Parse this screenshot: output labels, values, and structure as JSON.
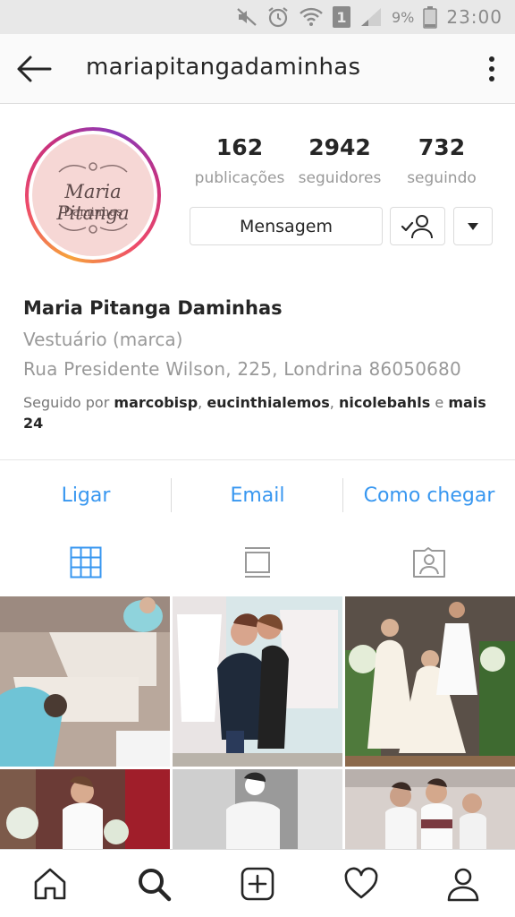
{
  "status_bar": {
    "battery_percent": "9%",
    "time": "23:00",
    "sim_slot": "1",
    "icons": [
      "mute-icon",
      "alarm-icon",
      "wifi-icon",
      "sim-icon",
      "signal-icon",
      "battery-icon"
    ]
  },
  "header": {
    "username": "mariapitangadaminhas",
    "icons": [
      "back-arrow-icon",
      "more-options-icon"
    ]
  },
  "profile": {
    "avatar_text_line1": "Maria Pitanga",
    "avatar_text_line2": "Daminhas",
    "stats": [
      {
        "value": "162",
        "label": "publicações"
      },
      {
        "value": "2942",
        "label": "seguidores"
      },
      {
        "value": "732",
        "label": "seguindo"
      }
    ],
    "message_button": "Mensagem",
    "ring_colors": [
      "#f6a33b",
      "#ee4b6a",
      "#c9317d",
      "#8a3ab9"
    ]
  },
  "bio": {
    "name": "Maria Pitanga Daminhas",
    "category": "Vestuário (marca)",
    "address": "Rua Presidente Wilson, 225, Londrina 86050680",
    "followed_prefix": "Seguido por",
    "followed_users": [
      "marcobisp",
      "eucinthialemos",
      "nicolebahls"
    ],
    "followed_and": "e",
    "followed_more": "mais 24"
  },
  "contact": {
    "call": "Ligar",
    "email": "Email",
    "directions": "Como chegar",
    "accent_color": "#3897f0"
  },
  "tabs": [
    {
      "icon": "grid-icon",
      "active": true
    },
    {
      "icon": "feed-icon",
      "active": false
    },
    {
      "icon": "tagged-icon",
      "active": false
    }
  ],
  "bottom_nav": [
    "home-icon",
    "search-icon",
    "add-post-icon",
    "activity-heart-icon",
    "profile-icon"
  ]
}
